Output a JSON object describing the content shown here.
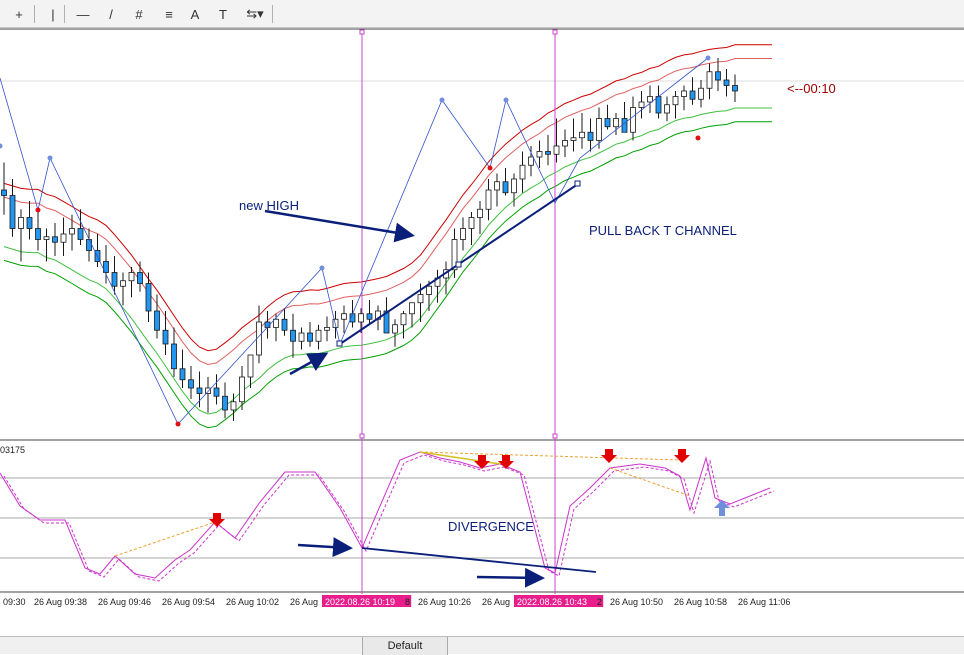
{
  "toolbar": {
    "buttons": [
      {
        "name": "crosshair-icon",
        "glyph": "+"
      },
      {
        "name": "vertical-line-icon",
        "glyph": "|"
      },
      {
        "name": "horizontal-line-icon",
        "glyph": "—"
      },
      {
        "name": "trendline-icon",
        "glyph": "/"
      },
      {
        "name": "fibonacci-expansion-icon",
        "glyph": "#"
      },
      {
        "name": "fibonacci-fan-icon",
        "glyph": "≡"
      },
      {
        "name": "text-icon",
        "glyph": "A"
      },
      {
        "name": "text-label-icon",
        "glyph": "T"
      },
      {
        "name": "arrows-dropdown-icon",
        "glyph": "⇆▾"
      }
    ]
  },
  "tabs": {
    "default_label": "Default"
  },
  "colors": {
    "candle_up_fill": "#ffffff",
    "candle_down_fill": "#2196f3",
    "candle_outline": "#1a1a1a",
    "outer_band": "#cc0000",
    "inner_band": "#e06060",
    "lower_band_outer": "#00a000",
    "lower_band_inner": "#40c040",
    "separator_lines": "#cc44cc",
    "annotation": "#0a1f7a",
    "highlight": "#e91e8c",
    "oscillator": "#cc33cc",
    "divergence_line": "#f0a030",
    "sell_arrow": "#e00000",
    "buy_arrow": "#6f8fdc",
    "countdown": "#a00000"
  },
  "chart_data": {
    "type": "candlestick",
    "price_panel": {
      "countdown_label": "<--00:10",
      "annotations": [
        "new HIGH",
        "PULL BACK T CHANNEL"
      ]
    },
    "oscillator_panel": {
      "value_label": "03175",
      "annotation": "DIVERGENCE"
    },
    "x_axis_labels": [
      "09:30",
      "26 Aug 09:38",
      "26 Aug 09:46",
      "26 Aug 09:54",
      "26 Aug 10:02",
      "26 Aug",
      "2022.08.26 10:19",
      "8",
      "26 Aug 10:26",
      "26 Aug",
      "2022.08.26 10:43",
      "2",
      "26 Aug 10:50",
      "26 Aug 10:58",
      "26 Aug 11:06"
    ],
    "highlighted_times": [
      "2022.08.26 10:19",
      "2022.08.26 10:43"
    ],
    "candles": [
      {
        "o": 56,
        "h": 46,
        "l": 65,
        "c": 58
      },
      {
        "o": 58,
        "h": 52,
        "l": 73,
        "c": 70
      },
      {
        "o": 70,
        "h": 63,
        "l": 82,
        "c": 66
      },
      {
        "o": 66,
        "h": 60,
        "l": 74,
        "c": 70
      },
      {
        "o": 70,
        "h": 64,
        "l": 78,
        "c": 74
      },
      {
        "o": 74,
        "h": 70,
        "l": 82,
        "c": 73
      },
      {
        "o": 73,
        "h": 68,
        "l": 80,
        "c": 75
      },
      {
        "o": 75,
        "h": 66,
        "l": 80,
        "c": 72
      },
      {
        "o": 72,
        "h": 65,
        "l": 78,
        "c": 70
      },
      {
        "o": 70,
        "h": 63,
        "l": 76,
        "c": 74
      },
      {
        "o": 74,
        "h": 70,
        "l": 82,
        "c": 78
      },
      {
        "o": 78,
        "h": 72,
        "l": 84,
        "c": 82
      },
      {
        "o": 82,
        "h": 76,
        "l": 90,
        "c": 86
      },
      {
        "o": 86,
        "h": 80,
        "l": 94,
        "c": 91
      },
      {
        "o": 91,
        "h": 86,
        "l": 98,
        "c": 89
      },
      {
        "o": 89,
        "h": 84,
        "l": 95,
        "c": 86
      },
      {
        "o": 86,
        "h": 82,
        "l": 93,
        "c": 90
      },
      {
        "o": 90,
        "h": 86,
        "l": 104,
        "c": 100
      },
      {
        "o": 100,
        "h": 94,
        "l": 110,
        "c": 107
      },
      {
        "o": 107,
        "h": 100,
        "l": 116,
        "c": 112
      },
      {
        "o": 112,
        "h": 106,
        "l": 124,
        "c": 121
      },
      {
        "o": 121,
        "h": 114,
        "l": 128,
        "c": 125
      },
      {
        "o": 125,
        "h": 120,
        "l": 132,
        "c": 128
      },
      {
        "o": 128,
        "h": 122,
        "l": 135,
        "c": 130
      },
      {
        "o": 130,
        "h": 124,
        "l": 137,
        "c": 128
      },
      {
        "o": 128,
        "h": 123,
        "l": 134,
        "c": 131
      },
      {
        "o": 131,
        "h": 126,
        "l": 139,
        "c": 136
      },
      {
        "o": 136,
        "h": 130,
        "l": 140,
        "c": 133
      },
      {
        "o": 133,
        "h": 120,
        "l": 136,
        "c": 124
      },
      {
        "o": 124,
        "h": 118,
        "l": 128,
        "c": 116
      },
      {
        "o": 116,
        "h": 98,
        "l": 119,
        "c": 104
      },
      {
        "o": 104,
        "h": 100,
        "l": 110,
        "c": 106
      },
      {
        "o": 106,
        "h": 101,
        "l": 111,
        "c": 103
      },
      {
        "o": 103,
        "h": 99,
        "l": 109,
        "c": 107
      },
      {
        "o": 107,
        "h": 101,
        "l": 117,
        "c": 111
      },
      {
        "o": 111,
        "h": 106,
        "l": 114,
        "c": 108
      },
      {
        "o": 108,
        "h": 104,
        "l": 113,
        "c": 111
      },
      {
        "o": 111,
        "h": 105,
        "l": 114,
        "c": 107
      },
      {
        "o": 107,
        "h": 102,
        "l": 111,
        "c": 106
      },
      {
        "o": 106,
        "h": 100,
        "l": 110,
        "c": 103
      },
      {
        "o": 103,
        "h": 98,
        "l": 108,
        "c": 101
      },
      {
        "o": 101,
        "h": 96,
        "l": 106,
        "c": 104
      },
      {
        "o": 104,
        "h": 99,
        "l": 108,
        "c": 101
      },
      {
        "o": 101,
        "h": 96,
        "l": 105,
        "c": 103
      },
      {
        "o": 103,
        "h": 98,
        "l": 107,
        "c": 100
      },
      {
        "o": 100,
        "h": 95,
        "l": 105,
        "c": 108
      },
      {
        "o": 108,
        "h": 103,
        "l": 113,
        "c": 105
      },
      {
        "o": 105,
        "h": 100,
        "l": 110,
        "c": 101
      },
      {
        "o": 101,
        "h": 97,
        "l": 106,
        "c": 97
      },
      {
        "o": 97,
        "h": 90,
        "l": 104,
        "c": 94
      },
      {
        "o": 94,
        "h": 89,
        "l": 100,
        "c": 91
      },
      {
        "o": 91,
        "h": 85,
        "l": 97,
        "c": 88
      },
      {
        "o": 88,
        "h": 82,
        "l": 94,
        "c": 85
      },
      {
        "o": 85,
        "h": 70,
        "l": 88,
        "c": 74
      },
      {
        "o": 74,
        "h": 66,
        "l": 78,
        "c": 70
      },
      {
        "o": 70,
        "h": 64,
        "l": 76,
        "c": 66
      },
      {
        "o": 66,
        "h": 60,
        "l": 72,
        "c": 63
      },
      {
        "o": 63,
        "h": 52,
        "l": 67,
        "c": 56
      },
      {
        "o": 56,
        "h": 50,
        "l": 62,
        "c": 53
      },
      {
        "o": 53,
        "h": 48,
        "l": 58,
        "c": 57
      },
      {
        "o": 57,
        "h": 50,
        "l": 62,
        "c": 52
      },
      {
        "o": 52,
        "h": 42,
        "l": 57,
        "c": 47
      },
      {
        "o": 47,
        "h": 40,
        "l": 51,
        "c": 44
      },
      {
        "o": 44,
        "h": 38,
        "l": 48,
        "c": 42
      },
      {
        "o": 42,
        "h": 36,
        "l": 47,
        "c": 43
      },
      {
        "o": 43,
        "h": 30,
        "l": 46,
        "c": 40
      },
      {
        "o": 40,
        "h": 34,
        "l": 44,
        "c": 38
      },
      {
        "o": 38,
        "h": 30,
        "l": 42,
        "c": 37
      },
      {
        "o": 37,
        "h": 28,
        "l": 41,
        "c": 35
      },
      {
        "o": 35,
        "h": 30,
        "l": 42,
        "c": 38
      },
      {
        "o": 38,
        "h": 26,
        "l": 41,
        "c": 30
      },
      {
        "o": 30,
        "h": 25,
        "l": 34,
        "c": 33
      },
      {
        "o": 33,
        "h": 28,
        "l": 36,
        "c": 30
      },
      {
        "o": 30,
        "h": 24,
        "l": 35,
        "c": 35
      },
      {
        "o": 35,
        "h": 22,
        "l": 38,
        "c": 26
      },
      {
        "o": 26,
        "h": 20,
        "l": 30,
        "c": 24
      },
      {
        "o": 24,
        "h": 18,
        "l": 28,
        "c": 22
      },
      {
        "o": 22,
        "h": 18,
        "l": 30,
        "c": 28
      },
      {
        "o": 28,
        "h": 22,
        "l": 31,
        "c": 25
      },
      {
        "o": 25,
        "h": 20,
        "l": 30,
        "c": 22
      },
      {
        "o": 22,
        "h": 18,
        "l": 27,
        "c": 20
      },
      {
        "o": 20,
        "h": 15,
        "l": 25,
        "c": 23
      },
      {
        "o": 23,
        "h": 16,
        "l": 26,
        "c": 19
      },
      {
        "o": 19,
        "h": 10,
        "l": 23,
        "c": 13
      },
      {
        "o": 13,
        "h": 8,
        "l": 20,
        "c": 16
      },
      {
        "o": 16,
        "h": 12,
        "l": 22,
        "c": 18
      },
      {
        "o": 18,
        "h": 14,
        "l": 24,
        "c": 20
      }
    ]
  }
}
